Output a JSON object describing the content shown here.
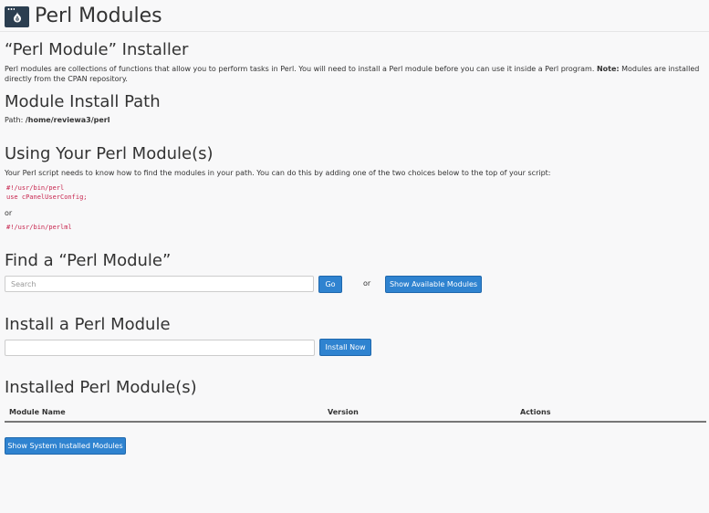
{
  "header": {
    "title": "Perl Modules",
    "icon": "perl-onion-icon"
  },
  "installer": {
    "heading": "“Perl Module” Installer",
    "description": "Perl modules are collections of functions that allow you to perform tasks in Perl. You will need to install a Perl module before you can use it inside a Perl program.",
    "note_label": "Note:",
    "note_text": "Modules are installed directly from the CPAN repository."
  },
  "install_path": {
    "heading": "Module Install Path",
    "label": "Path:",
    "value": "/home/reviewa3/perl"
  },
  "using": {
    "heading": "Using Your Perl Module(s)",
    "description": "Your Perl script needs to know how to find the modules in your path. You can do this by adding one of the two choices below to the top of your script:",
    "code_option_1_line_1": "#!/usr/bin/perl",
    "code_option_1_line_2": "use cPanelUserConfig;",
    "or_text": "or",
    "code_option_2": "#!/usr/bin/perlml"
  },
  "find": {
    "heading": "Find a “Perl Module”",
    "search_placeholder": "Search",
    "go_label": "Go",
    "or_text": "or",
    "show_available_label": "Show Available Modules"
  },
  "install": {
    "heading": "Install a Perl Module",
    "input_value": "",
    "install_now_label": "Install Now"
  },
  "installed": {
    "heading": "Installed Perl Module(s)",
    "columns": [
      "Module Name",
      "Version",
      "Actions"
    ],
    "show_system_label": "Show System Installed Modules"
  },
  "colors": {
    "primary_button": "#2f83d0",
    "code_text": "#c7254e",
    "icon_background": "#2b3e50"
  }
}
